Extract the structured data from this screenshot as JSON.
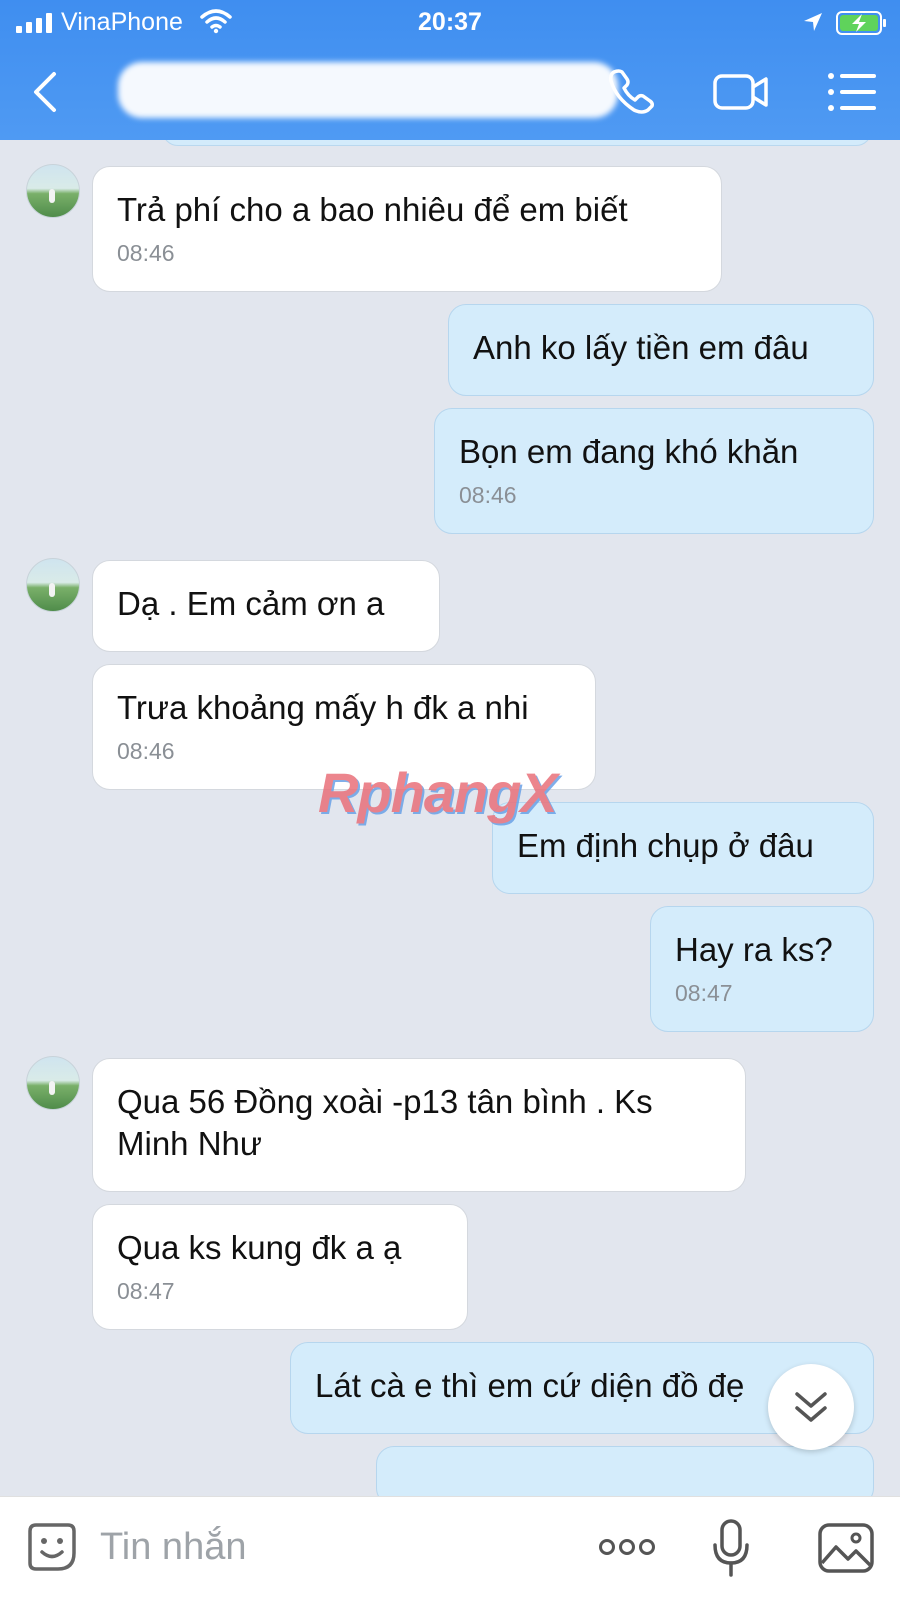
{
  "status_bar": {
    "carrier": "VinaPhone",
    "time": "20:37"
  },
  "header": {
    "contact_name": "",
    "icons": [
      "back-icon",
      "phone-icon",
      "video-camera-icon",
      "menu-icon"
    ]
  },
  "messages": [
    {
      "side": "in",
      "avatar": true,
      "text": "Trả phí cho a bao nhiêu để em biết",
      "time": "08:46"
    },
    {
      "side": "out",
      "text": "Anh ko lấy tiền em đâu",
      "time": ""
    },
    {
      "side": "out",
      "text": "Bọn em đang khó khăn",
      "time": "08:46"
    },
    {
      "side": "in",
      "avatar": true,
      "text": "Dạ . Em cảm ơn a",
      "time": ""
    },
    {
      "side": "in",
      "text": "Trưa khoảng mấy h đk a nhi",
      "time": "08:46"
    },
    {
      "side": "out",
      "text": "Em định chụp ở đâu",
      "time": ""
    },
    {
      "side": "out",
      "text": "Hay ra ks?",
      "time": "08:47"
    },
    {
      "side": "in",
      "avatar": true,
      "text": "Qua 56 Đồng xoài -p13 tân bình . Ks Minh Như",
      "time": ""
    },
    {
      "side": "in",
      "text": "Qua ks kung đk a ạ",
      "time": "08:47"
    },
    {
      "side": "out",
      "text": "Lát cà e thì em cứ diện đồ đẹ",
      "time": ""
    }
  ],
  "watermark": "RphangX",
  "input_bar": {
    "placeholder": "Tin nhắn",
    "icons": [
      "sticker-icon",
      "more-icon",
      "mic-icon",
      "image-icon"
    ]
  },
  "colors": {
    "header": "#4a95f2",
    "chat_background": "#e2e6ee",
    "incoming_bubble": "#ffffff",
    "outgoing_bubble": "#d4ecfb"
  }
}
